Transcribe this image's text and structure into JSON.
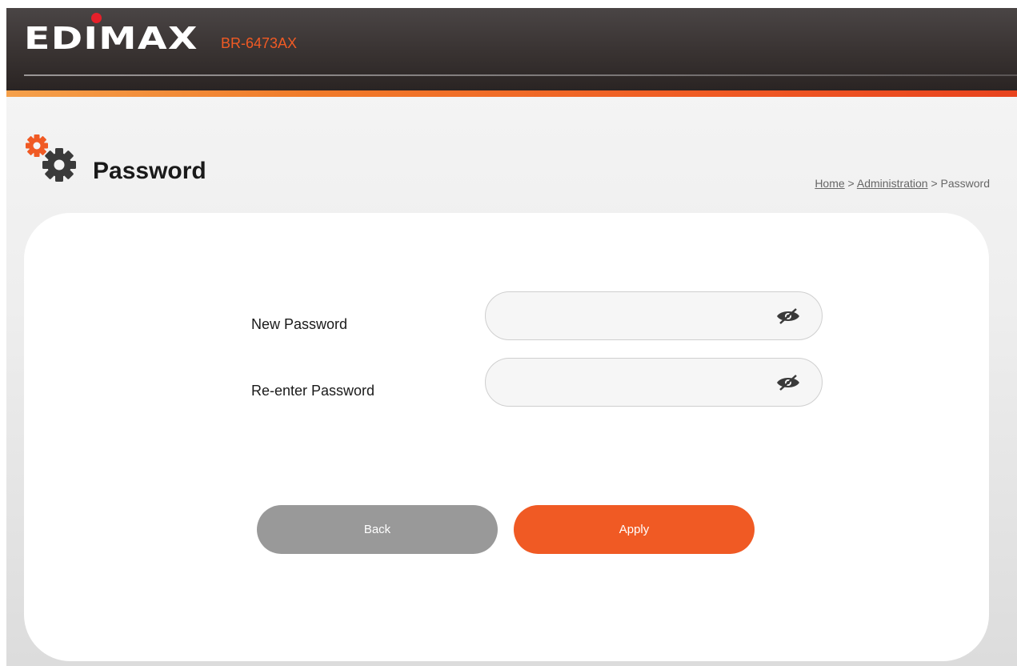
{
  "header": {
    "logo_text": "EDIMAX",
    "model": "BR-6473AX"
  },
  "page": {
    "title": "Password",
    "title_icon": "gears-icon"
  },
  "breadcrumb": {
    "home": "Home",
    "sep1": " > ",
    "section": "Administration",
    "sep2": " > ",
    "current": "Password"
  },
  "form": {
    "new_password_label": "New Password",
    "new_password_value": "",
    "reenter_password_label": "Re-enter Password",
    "reenter_password_value": "",
    "toggle_icon": "eye-hidden-icon"
  },
  "buttons": {
    "back": "Back",
    "apply": "Apply"
  },
  "colors": {
    "accent": "#f05a24",
    "header_bg": "#3a3433",
    "back_button": "#999999"
  }
}
